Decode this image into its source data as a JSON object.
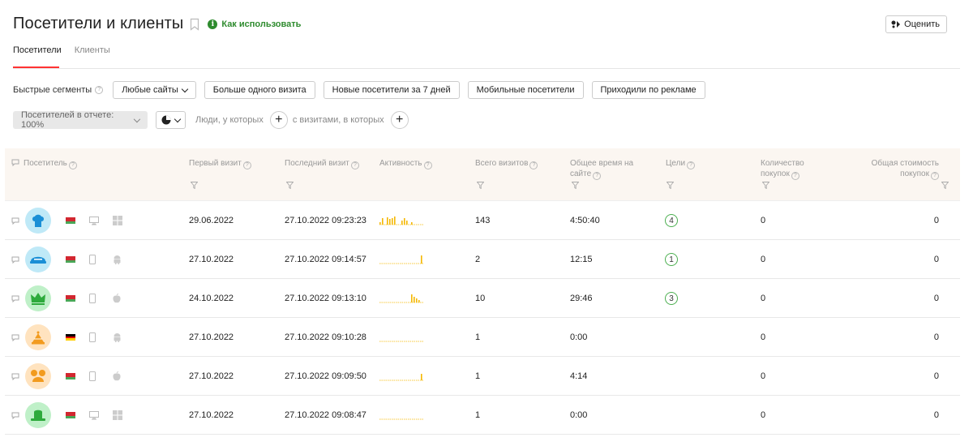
{
  "header": {
    "title": "Посетители и клиенты",
    "howto_label": "Как использовать",
    "rate_label": "Оценить"
  },
  "tabs": [
    {
      "label": "Посетители",
      "active": true
    },
    {
      "label": "Клиенты",
      "active": false
    }
  ],
  "segments": {
    "label": "Быстрые сегменты",
    "sites_dropdown": "Любые сайты",
    "buttons": [
      "Больше одного визита",
      "Новые посетители за 7 дней",
      "Мобильные посетители",
      "Приходили по рекламе"
    ]
  },
  "filters": {
    "percent_label": "Посетителей в отчете: 100%",
    "people_text": "Люди, у которых",
    "visits_text": "с визитами, в которых"
  },
  "table": {
    "headers": {
      "visitor": "Посетитель",
      "first_visit": "Первый визит",
      "last_visit": "Последний визит",
      "activity": "Активность",
      "total_visits": "Всего визитов",
      "total_time_1": "Общее время на",
      "total_time_2": "сайте",
      "goals": "Цели",
      "purchases_1": "Количество",
      "purchases_2": "покупок",
      "cost_1": "Общая стоимость",
      "cost_2": "покупок"
    },
    "rows": [
      {
        "avatar_icon": "chef-hat-icon",
        "avatar_bg": "#bfe9f7",
        "avatar_color": "#1a8fd6",
        "flag": "belarus",
        "device": "desktop",
        "os": "windows",
        "first_visit": "29.06.2022",
        "last_visit": "27.10.2022 09:23:23",
        "activity": [
          3,
          8,
          0,
          9,
          7,
          8,
          10,
          0,
          0,
          5,
          8,
          5,
          0,
          3
        ],
        "visits": "143",
        "time": "4:50:40",
        "goals": "4",
        "purchases": "0",
        "cost": "0"
      },
      {
        "avatar_icon": "captain-hat-icon",
        "avatar_bg": "#bfe9f7",
        "avatar_color": "#1a8fd6",
        "flag": "belarus",
        "device": "mobile",
        "os": "android",
        "first_visit": "27.10.2022",
        "last_visit": "27.10.2022 09:14:57",
        "activity": [
          0,
          0,
          0,
          0,
          0,
          0,
          0,
          0,
          0,
          0,
          0,
          0,
          0,
          0,
          0,
          0,
          0,
          10
        ],
        "visits": "2",
        "time": "12:15",
        "goals": "1",
        "purchases": "0",
        "cost": "0"
      },
      {
        "avatar_icon": "crown-icon",
        "avatar_bg": "#bff0c8",
        "avatar_color": "#2eaa3c",
        "flag": "belarus",
        "device": "mobile",
        "os": "apple",
        "first_visit": "24.10.2022",
        "last_visit": "27.10.2022 09:13:10",
        "activity": [
          0,
          0,
          0,
          0,
          0,
          0,
          0,
          0,
          0,
          0,
          0,
          0,
          0,
          10,
          7,
          5,
          3
        ],
        "visits": "10",
        "time": "29:46",
        "goals": "3",
        "purchases": "0",
        "cost": "0"
      },
      {
        "avatar_icon": "cake-icon",
        "avatar_bg": "#ffe3bf",
        "avatar_color": "#f29b1f",
        "flag": "germany",
        "device": "mobile",
        "os": "android",
        "first_visit": "27.10.2022",
        "last_visit": "27.10.2022 09:10:28",
        "activity": [],
        "visits": "1",
        "time": "0:00",
        "goals": "",
        "purchases": "0",
        "cost": "0"
      },
      {
        "avatar_icon": "mouse-ears-icon",
        "avatar_bg": "#ffe3bf",
        "avatar_color": "#f29b1f",
        "flag": "belarus",
        "device": "mobile",
        "os": "apple",
        "first_visit": "27.10.2022",
        "last_visit": "27.10.2022 09:09:50",
        "activity": [
          0,
          0,
          0,
          0,
          0,
          0,
          0,
          0,
          0,
          0,
          0,
          0,
          0,
          0,
          0,
          0,
          0,
          8
        ],
        "visits": "1",
        "time": "4:14",
        "goals": "",
        "purchases": "0",
        "cost": "0"
      },
      {
        "avatar_icon": "green-hat-icon",
        "avatar_bg": "#bff0c8",
        "avatar_color": "#2eaa3c",
        "flag": "belarus",
        "device": "desktop",
        "os": "windows",
        "first_visit": "27.10.2022",
        "last_visit": "27.10.2022 09:08:47",
        "activity": [],
        "visits": "1",
        "time": "0:00",
        "goals": "",
        "purchases": "0",
        "cost": "0"
      }
    ]
  }
}
